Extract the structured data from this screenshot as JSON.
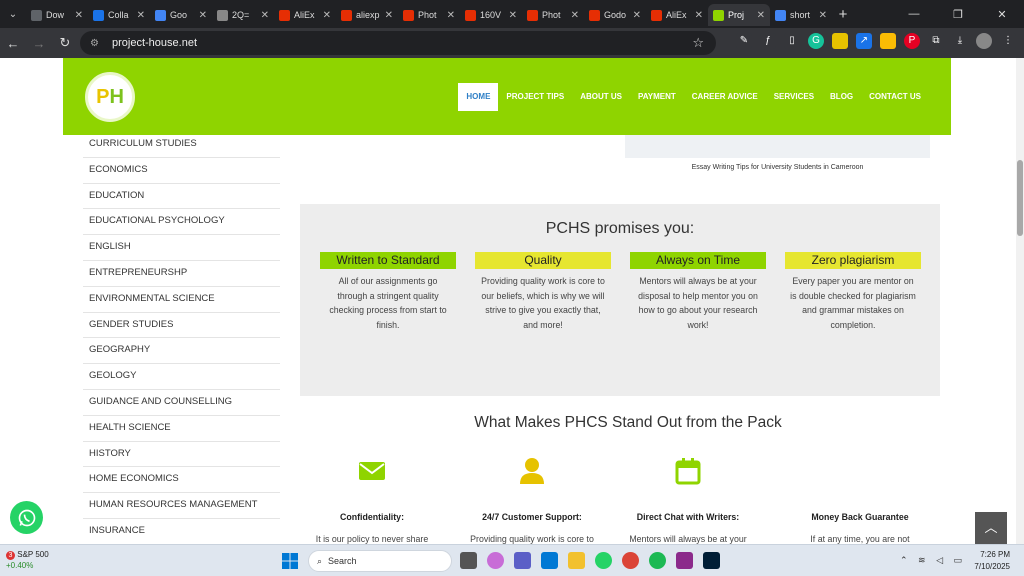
{
  "browser": {
    "tabs": [
      {
        "title": "Dow",
        "color": "#5f6368"
      },
      {
        "title": "Colla",
        "color": "#1a73e8"
      },
      {
        "title": "Goo",
        "color": "#4285f4"
      },
      {
        "title": "2Q=",
        "color": "#888888"
      },
      {
        "title": "AliEx",
        "color": "#e62e04"
      },
      {
        "title": "aliexp",
        "color": "#e62e04"
      },
      {
        "title": "Phot",
        "color": "#e62e04"
      },
      {
        "title": "160V",
        "color": "#e62e04"
      },
      {
        "title": "Phot",
        "color": "#e62e04"
      },
      {
        "title": "Godo",
        "color": "#e62e04"
      },
      {
        "title": "AliEx",
        "color": "#e62e04"
      },
      {
        "title": "Proj",
        "color": "#8fd400"
      },
      {
        "title": "short",
        "color": "#4285f4"
      }
    ],
    "active_tab_index": 11,
    "url": "project-house.net"
  },
  "site": {
    "brand_color": "#8fd400",
    "logo_text_1": "P",
    "logo_text_2": "H",
    "nav": [
      "HOME",
      "PROJECT TIPS",
      "ABOUT US",
      "PAYMENT",
      "CAREER ADVICE",
      "SERVICES",
      "BLOG",
      "CONTACT US"
    ],
    "nav_active": "HOME"
  },
  "sidebar": {
    "items": [
      "CURRICULUM STUDIES",
      "ECONOMICS",
      "EDUCATION",
      "EDUCATIONAL PSYCHOLOGY",
      "ENGLISH",
      "ENTREPRENEURSHP",
      "ENVIRONMENTAL SCIENCE",
      "GENDER STUDIES",
      "GEOGRAPHY",
      "GEOLOGY",
      "GUIDANCE AND COUNSELLING",
      "HEALTH SCIENCE",
      "HISTORY",
      "HOME ECONOMICS",
      "HUMAN RESOURCES MANAGEMENT",
      "INSURANCE"
    ]
  },
  "article": {
    "image_caption": "Essay Writing Tips for University Students in Cameroon"
  },
  "promise": {
    "heading": "PCHS promises you:",
    "columns": [
      {
        "tag": "Written to Standard",
        "color": "green",
        "desc": "All of our assignments go through a stringent quality checking process from start to finish."
      },
      {
        "tag": "Quality",
        "color": "yellow",
        "desc": "Providing quality work is core to our beliefs, which is why we will strive to give you exactly that, and more!"
      },
      {
        "tag": "Always on Time",
        "color": "green",
        "desc": "Mentors will always be at your disposal to help mentor you on how to go about your research work!"
      },
      {
        "tag": "Zero plagiarism",
        "color": "yellow",
        "desc": "Every paper you are mentor on is double checked for plagiarism and grammar mistakes on completion."
      }
    ]
  },
  "standout": {
    "heading": "What Makes PHCS Stand Out from the Pack",
    "features": [
      {
        "icon": "envelope-icon",
        "title": "Confidentiality:",
        "desc": "It is our policy to never share"
      },
      {
        "icon": "user-icon",
        "title": "24/7 Customer Support:",
        "desc": "Providing quality work is core to"
      },
      {
        "icon": "calendar-icon",
        "title": "Direct Chat with Writers:",
        "desc": "Mentors will always be at your"
      },
      {
        "icon": "money-icon",
        "title": "Money Back Guarantee",
        "desc": "If at any time, you are not"
      }
    ]
  },
  "taskbar": {
    "stock_badge": "3",
    "stock_name": "S&P 500",
    "stock_change": "+0.40%",
    "search_placeholder": "Search",
    "time": "7:26 PM",
    "date": "7/10/2025"
  }
}
